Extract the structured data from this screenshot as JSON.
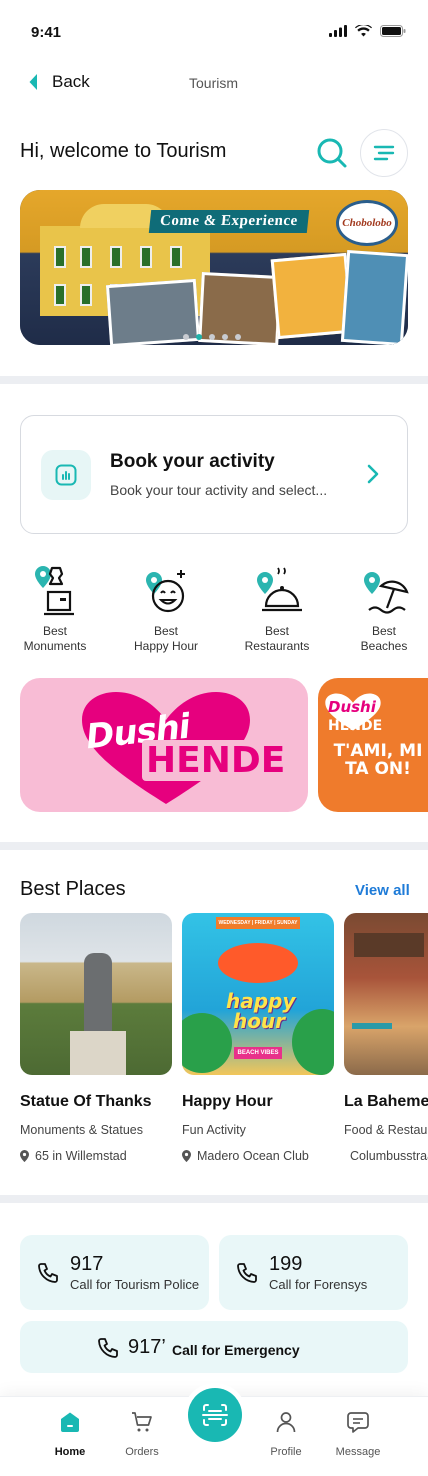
{
  "status": {
    "time": "9:41"
  },
  "nav": {
    "back_label": "Back",
    "title": "Tourism"
  },
  "header": {
    "welcome": "Hi, welcome to Tourism"
  },
  "banner": {
    "caption": "Come & Experience",
    "badge": "Chobolobo",
    "slides": 5,
    "active_slide": 2
  },
  "book": {
    "title": "Book your activity",
    "subtitle": "Book your tour activity and select..."
  },
  "categories": [
    {
      "line1": "Best",
      "line2": "Monuments"
    },
    {
      "line1": "Best",
      "line2": "Happy Hour"
    },
    {
      "line1": "Best",
      "line2": "Restaurants"
    },
    {
      "line1": "Best",
      "line2": "Beaches"
    }
  ],
  "promos": [
    {
      "line1": "Dushi",
      "line2": "HENDE"
    },
    {
      "line1": "Dushi",
      "line2": "HENDE",
      "tagline": "T'AMI, MI TA ON!"
    }
  ],
  "best_places": {
    "title": "Best Places",
    "view_all": "View all",
    "items": [
      {
        "name": "Statue Of Thanks",
        "category": "Monuments & Statues",
        "location": "65 in Willemstad"
      },
      {
        "name": "Happy Hour",
        "category": "Fun Activity",
        "location": "Madero Ocean Club",
        "poster_top": "WEDNESDAY | FRIDAY | SUNDAY",
        "poster_title": "happy hour",
        "poster_sub": "BEACH VIBES"
      },
      {
        "name": "La Baheme",
        "category": "Food & Restaurant",
        "location": "Columbusstraat"
      }
    ]
  },
  "calls": [
    {
      "number": "917",
      "label": "Call for Tourism Police"
    },
    {
      "number": "199",
      "label": "Call for Forensys"
    },
    {
      "number": "917’",
      "label": "Call for Emergency"
    }
  ],
  "tabs": {
    "home": "Home",
    "orders": "Orders",
    "profile": "Profile",
    "message": "Message"
  },
  "colors": {
    "accent": "#19b8b3",
    "link": "#1e7bd8",
    "card_bg": "#e9f7f8",
    "promo_pink": "#f8bcd5",
    "promo_orange": "#ef7b2c",
    "brand_magenta": "#e6007e"
  }
}
